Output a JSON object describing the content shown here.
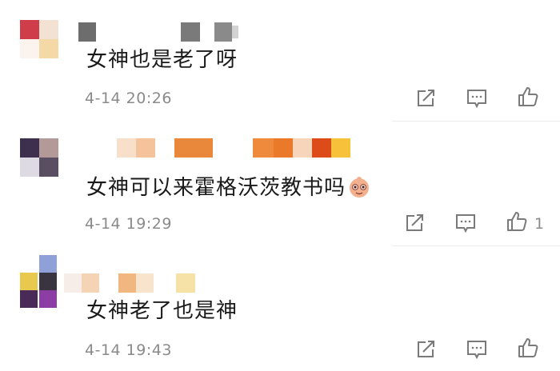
{
  "comments": [
    {
      "text": "女神也是老了呀",
      "time": "4-14 20:26",
      "likes": ""
    },
    {
      "text": "女神可以来霍格沃茨教书吗",
      "time": "4-14 19:29",
      "likes": "1"
    },
    {
      "text": "女神老了也是神",
      "time": "4-14 19:43",
      "likes": ""
    }
  ],
  "icons": {
    "share": "share-icon",
    "comment": "comment-icon",
    "like": "thumbs-up-icon",
    "emoji": "grinning-emoji-icon"
  },
  "colors": {
    "text": "#1a1a1a",
    "meta": "#8a8a8a",
    "icon": "#7a7a7a"
  }
}
